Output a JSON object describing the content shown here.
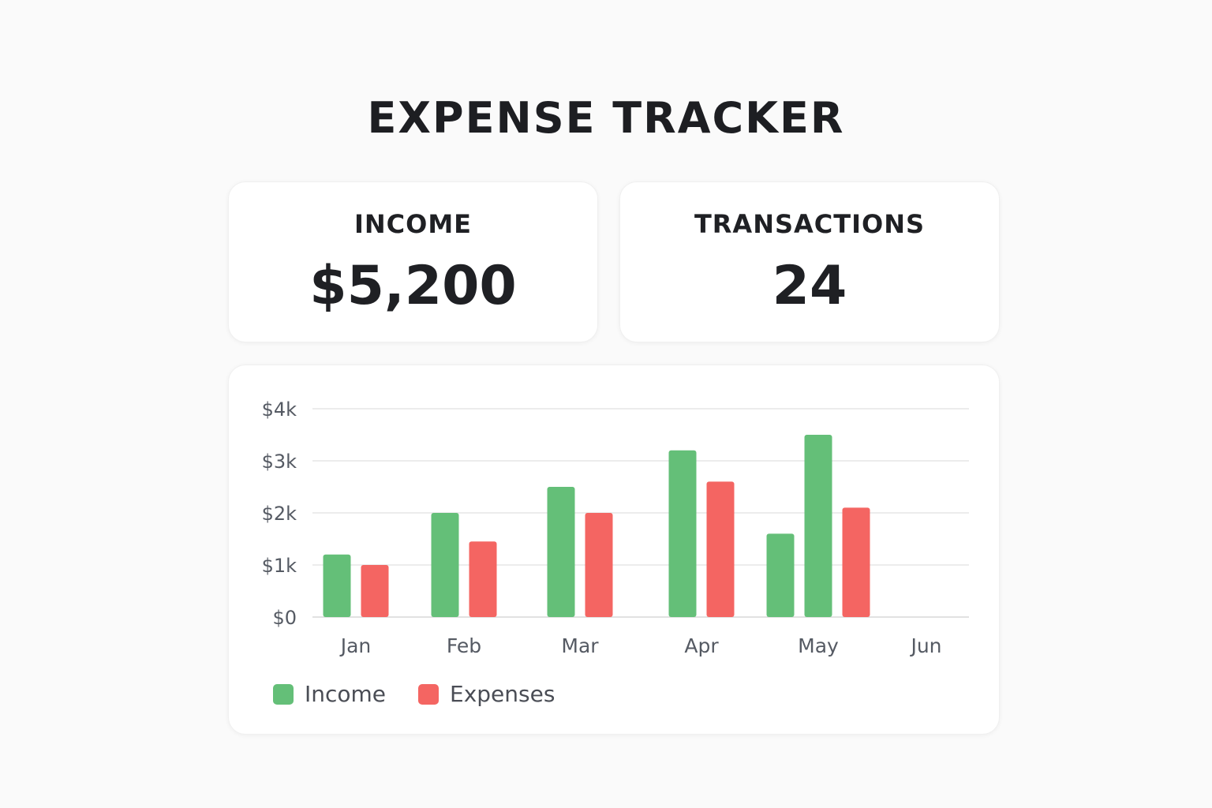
{
  "title": "EXPENSE TRACKER",
  "stats": [
    {
      "label": "INCOME",
      "value": "$5,200"
    },
    {
      "label": "TRANSACTIONS",
      "value": "24"
    }
  ],
  "colors": {
    "income": "#64bf78",
    "expenses": "#f46562",
    "grid": "#e6e6e6",
    "axis_text": "#555a63"
  },
  "chart_data": {
    "type": "bar",
    "categories": [
      "Jan",
      "Feb",
      "Mar",
      "Apr",
      "May",
      "Jun"
    ],
    "y_ticks": [
      "$0",
      "$1k",
      "$2k",
      "$3k",
      "$4k"
    ],
    "ylim": [
      0,
      4000
    ],
    "grid": true,
    "legend_position": "bottom-left",
    "series": [
      {
        "name": "Income",
        "values": [
          1200,
          2000,
          2500,
          3200,
          3500,
          null
        ]
      },
      {
        "name": "Expenses",
        "values": [
          1000,
          1450,
          2000,
          2600,
          2100,
          null
        ]
      }
    ],
    "extra_bars": [
      {
        "category": "May",
        "series": "Income",
        "value": 1600
      }
    ]
  },
  "legend": [
    {
      "label": "Income",
      "color": "#64bf78"
    },
    {
      "label": "Expenses",
      "color": "#f46562"
    }
  ]
}
